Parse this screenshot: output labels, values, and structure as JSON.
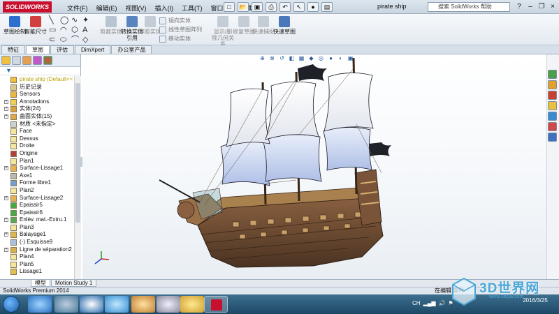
{
  "app": {
    "brand": "SOLIDWORKS",
    "doc_title": "pirate ship",
    "search_placeholder": "搜索 SolidWorks 帮助",
    "status_left": "SolidWorks Premium 2014",
    "status_right": "在编辑 零件"
  },
  "menu": [
    "文件(F)",
    "编辑(E)",
    "视图(V)",
    "插入(I)",
    "工具(T)",
    "窗口(W)",
    "帮助(H)"
  ],
  "command_manager": {
    "big_buttons": [
      {
        "label": "草图绘制",
        "icon": "sketch-icon"
      },
      {
        "label": "智能尺寸",
        "icon": "smart-dimension-icon"
      },
      {
        "label": "剪裁实体",
        "icon": "trim-entities-icon"
      },
      {
        "label": "转换实体引用",
        "icon": "convert-entities-icon"
      },
      {
        "label": "等距实体",
        "icon": "offset-entities-icon"
      },
      {
        "label": "显示/删除几何关系",
        "icon": "display-relations-icon"
      },
      {
        "label": "修复草图",
        "icon": "repair-sketch-icon"
      },
      {
        "label": "快速捕捉",
        "icon": "quick-snaps-icon"
      },
      {
        "label": "快速草图",
        "icon": "rapid-sketch-icon"
      }
    ],
    "small_buttons": [
      "镜向实体",
      "线性草图阵列",
      "移动实体"
    ]
  },
  "tabs": [
    "特征",
    "草图",
    "评估",
    "DimXpert",
    "办公室产品"
  ],
  "active_tab": "草图",
  "feature_tree": [
    {
      "label": "pirate ship  (Default<<",
      "icon": "part-icon",
      "expand": false,
      "root": true
    },
    {
      "label": "历史记录",
      "icon": "history-icon",
      "expand": false
    },
    {
      "label": "Sensors",
      "icon": "sensors-icon",
      "expand": false
    },
    {
      "label": "Annotations",
      "icon": "annotations-icon",
      "expand": true
    },
    {
      "label": "实体(24)",
      "icon": "solid-bodies-icon",
      "expand": true
    },
    {
      "label": "曲面实体(15)",
      "icon": "surface-bodies-icon",
      "expand": true
    },
    {
      "label": "材质 <未指定>",
      "icon": "material-icon",
      "expand": false
    },
    {
      "label": "Face",
      "icon": "plane-icon",
      "expand": false
    },
    {
      "label": "Dessus",
      "icon": "plane-icon",
      "expand": false
    },
    {
      "label": "Droite",
      "icon": "plane-icon",
      "expand": false
    },
    {
      "label": "Origine",
      "icon": "origin-icon",
      "expand": false
    },
    {
      "label": "Plan1",
      "icon": "plane-icon",
      "expand": false
    },
    {
      "label": "Surface-Lissage1",
      "icon": "surface-loft-icon",
      "expand": true
    },
    {
      "label": "Axe1",
      "icon": "axis-icon",
      "expand": false
    },
    {
      "label": "Forme libre1",
      "icon": "freeform-icon",
      "expand": false
    },
    {
      "label": "Plan2",
      "icon": "plane-icon",
      "expand": false
    },
    {
      "label": "Surface-Lissage2",
      "icon": "surface-loft-icon",
      "expand": true
    },
    {
      "label": "Epaissir5",
      "icon": "thicken-icon",
      "expand": false
    },
    {
      "label": "Epaissir6",
      "icon": "thicken-icon",
      "expand": false
    },
    {
      "label": "Enlèv. mat.-Extru.1",
      "icon": "extruded-cut-icon",
      "expand": true
    },
    {
      "label": "Plan3",
      "icon": "plane-icon",
      "expand": false
    },
    {
      "label": "Balayage1",
      "icon": "sweep-icon",
      "expand": true
    },
    {
      "label": "(-) Esquisse9",
      "icon": "sketch-icon",
      "expand": false
    },
    {
      "label": "Ligne de séparation2",
      "icon": "split-line-icon",
      "expand": true
    },
    {
      "label": "Plan4",
      "icon": "plane-icon",
      "expand": false
    },
    {
      "label": "Plan5",
      "icon": "plane-icon",
      "expand": false
    },
    {
      "label": "Lissage1",
      "icon": "loft-icon",
      "expand": false
    }
  ],
  "bottom_tabs": [
    "模型",
    "Motion Study 1"
  ],
  "active_bottom_tab": "模型",
  "clock": {
    "time": "",
    "date": "2016/3/25"
  },
  "watermark": {
    "text": "3D世界网",
    "sub": "www.3dsjw.com"
  },
  "colors": {
    "accent": "#c8102e",
    "sail": "#eef2fa",
    "sail_lower": "#c6d2ee",
    "hull": "#6b4a33",
    "deck": "#a8814f"
  }
}
